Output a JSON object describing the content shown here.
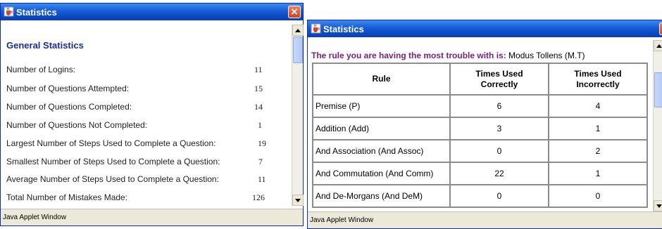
{
  "left_window": {
    "title": "Statistics",
    "section_title": "General Statistics",
    "stats": [
      {
        "label": "Number of Logins:",
        "value": "11"
      },
      {
        "label": "Number of Questions Attempted:",
        "value": "15"
      },
      {
        "label": "Number of Questions Completed:",
        "value": "14"
      },
      {
        "label": "Number of Questions Not Completed:",
        "value": "1"
      },
      {
        "label": "Largest Number of Steps Used to Complete a Question:",
        "value": "19"
      },
      {
        "label": "Smallest Number of Steps Used to Complete a Question:",
        "value": "7"
      },
      {
        "label": "Average Number of Steps Used to Complete a Question:",
        "value": "11"
      },
      {
        "label": "Total Number of Mistakes Made:",
        "value": "126"
      }
    ],
    "status": "Java Applet Window",
    "close_glyph": "×"
  },
  "right_window": {
    "title": "Statistics",
    "trouble_label": "The rule you are having the most trouble with is:",
    "trouble_value": "Modus Tollens (M.T)",
    "table": {
      "headers": [
        "Rule",
        "Times Used Correctly",
        "Times Used Incorrectly"
      ],
      "rows": [
        [
          "Premise (P)",
          "6",
          "4"
        ],
        [
          "Addition (Add)",
          "3",
          "1"
        ],
        [
          "And Association (And Assoc)",
          "0",
          "2"
        ],
        [
          "And Commutation (And Comm)",
          "22",
          "1"
        ],
        [
          "And De-Morgans (And DeM)",
          "0",
          "0"
        ]
      ]
    },
    "status": "Java Applet Window",
    "close_glyph": "×"
  },
  "icons": {
    "app_icon": "java-cup-icon",
    "close_icon": "close-icon",
    "scroll_up": "arrow-up-icon",
    "scroll_down": "arrow-down-icon"
  },
  "colors": {
    "titlebar": "#0b47c2",
    "section_title": "#1a2aa0",
    "trouble_label": "#7a1f7a",
    "close_button": "#d04020"
  }
}
